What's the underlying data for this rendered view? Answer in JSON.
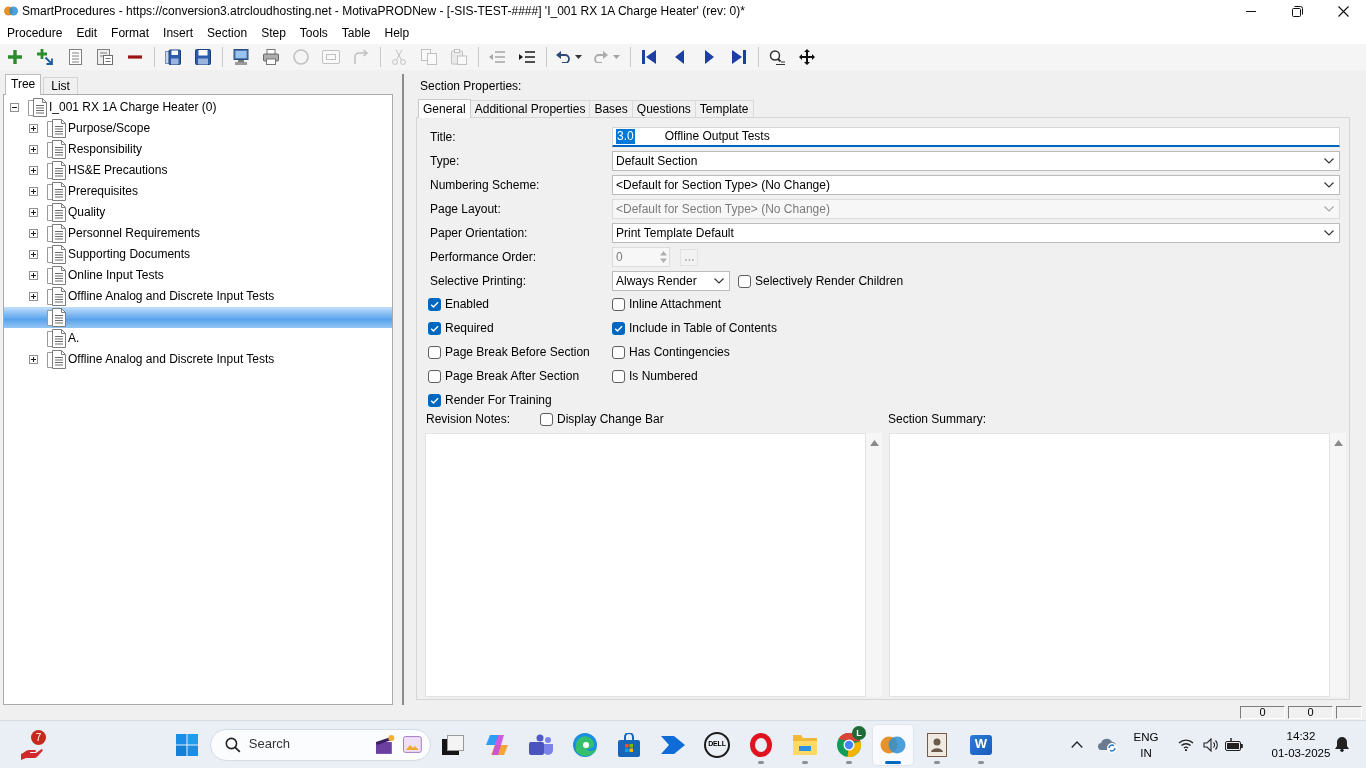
{
  "window": {
    "title": "SmartProcedures - https://conversion3.atrcloudhosting.net - MotivaPRODNew - [-SIS-TEST-####] 'I_001 RX 1A Charge Heater' (rev: 0)*"
  },
  "menu": [
    "Procedure",
    "Edit",
    "Format",
    "Insert",
    "Section",
    "Step",
    "Tools",
    "Table",
    "Help"
  ],
  "toolbar": [
    [
      {
        "disabled": false
      },
      {
        "disabled": false
      },
      {
        "disabled": false
      },
      {
        "disabled": false
      },
      {
        "disabled": false
      }
    ],
    [
      {
        "disabled": false
      },
      {
        "disabled": false
      }
    ],
    [
      {
        "disabled": false
      },
      {
        "disabled": false
      },
      {
        "disabled": true
      },
      {
        "disabled": true
      },
      {
        "disabled": true
      }
    ],
    [
      {
        "disabled": true
      },
      {
        "disabled": true
      },
      {
        "disabled": true
      }
    ],
    [
      {
        "disabled": true
      },
      {
        "disabled": false
      }
    ],
    [
      {
        "disabled": false,
        "dropdown": true
      },
      {
        "disabled": true,
        "dropdown": true
      }
    ],
    [
      {
        "disabled": false
      },
      {
        "disabled": false
      },
      {
        "disabled": false
      },
      {
        "disabled": false
      }
    ],
    [
      {
        "disabled": false
      },
      {
        "disabled": false
      }
    ]
  ],
  "tree_panel": {
    "tabs": [
      {
        "label": "Tree",
        "selected": true
      },
      {
        "label": "List",
        "selected": false
      }
    ],
    "nodes": [
      {
        "label": "I_001 RX 1A Charge Heater (0)",
        "expanded": true,
        "selected": false,
        "children": [
          {
            "label": "Purpose/Scope",
            "expanded": false,
            "selected": false
          },
          {
            "label": "Responsibility",
            "expanded": false,
            "selected": false
          },
          {
            "label": "HS&E Precautions",
            "expanded": false,
            "selected": false
          },
          {
            "label": "Prerequisites",
            "expanded": false,
            "selected": false
          },
          {
            "label": "Quality",
            "expanded": false,
            "selected": false
          },
          {
            "label": "Personnel Requirements",
            "expanded": false,
            "selected": false
          },
          {
            "label": "Supporting Documents",
            "expanded": false,
            "selected": false
          },
          {
            "label": "Online Input Tests",
            "expanded": false,
            "selected": false
          },
          {
            "label": "Offline Analog and Discrete Input Tests",
            "expanded": false,
            "selected": false
          },
          {
            "selected": true
          },
          {
            "label": "A.",
            "selected": false
          },
          {
            "label": "Offline Analog and Discrete Input Tests",
            "expanded": false,
            "selected": false
          }
        ]
      }
    ]
  },
  "section_properties": {
    "heading": "Section Properties:",
    "tabs": [
      {
        "label": "General",
        "selected": true
      },
      {
        "label": "Additional Properties",
        "selected": false
      },
      {
        "label": "Bases",
        "selected": false
      },
      {
        "label": "Questions",
        "selected": false
      },
      {
        "label": "Template",
        "selected": false
      }
    ],
    "fields": [
      {
        "kind": "text",
        "label": "Title:",
        "selection": "3.0",
        "value": "Offline Output Tests"
      },
      {
        "kind": "select",
        "label": "Type:",
        "value": "Default Section",
        "disabled": false
      },
      {
        "kind": "select",
        "label": "Numbering Scheme:",
        "value": "<Default for Section Type> (No Change)",
        "disabled": false
      },
      {
        "kind": "select",
        "label": "Page Layout:",
        "value": "<Default for Section Type> (No Change)",
        "disabled": true
      },
      {
        "kind": "select",
        "label": "Paper Orientation:",
        "value": "Print Template Default",
        "disabled": false
      },
      {
        "kind": "spin",
        "label": "Performance Order:",
        "value": "0",
        "disabled": true
      },
      {
        "kind": "combo",
        "label": "Selective Printing:",
        "value": "Always Render",
        "check": {
          "label": "Selectively Render Children",
          "checked": false
        }
      }
    ],
    "options": [
      {
        "label": "Enabled",
        "checked": true
      },
      {
        "label": "Inline Attachment",
        "checked": false
      },
      {
        "label": "Required",
        "checked": true
      },
      {
        "label": "Include in Table of Contents",
        "checked": true
      },
      {
        "label": "Page Break Before Section",
        "checked": false
      },
      {
        "label": "Has Contingencies",
        "checked": false
      },
      {
        "label": "Page Break After Section",
        "checked": false
      },
      {
        "label": "Is Numbered",
        "checked": false
      },
      {
        "label": "Render For Training",
        "checked": true
      }
    ],
    "revision_notes": {
      "label": "Revision Notes:",
      "change_bar": {
        "label": "Display Change Bar",
        "checked": false
      }
    },
    "section_summary": {
      "label": "Section Summary:"
    }
  },
  "status_bar": {
    "panels": [
      "0",
      "0"
    ]
  },
  "taskbar": {
    "widget_badge": "7",
    "search": {
      "placeholder": "Search"
    },
    "apps": [
      {
        "running": false,
        "selected": false
      },
      {
        "running": false,
        "selected": false
      },
      {
        "running": false,
        "selected": false
      },
      {
        "running": false,
        "selected": false
      },
      {
        "running": false,
        "selected": false
      },
      {
        "running": false,
        "selected": false
      },
      {
        "running": false,
        "selected": false,
        "logo_text": "DELL"
      },
      {
        "running": true,
        "selected": false
      },
      {
        "running": true,
        "selected": false
      },
      {
        "running": true,
        "selected": false,
        "badge": "L"
      },
      {
        "running": true,
        "selected": true
      },
      {
        "running": true,
        "selected": false
      },
      {
        "running": true,
        "selected": false,
        "logo_text": "W"
      }
    ],
    "language": "ENG",
    "region": "IN",
    "time": "14:32",
    "date": "01-03-2025"
  }
}
